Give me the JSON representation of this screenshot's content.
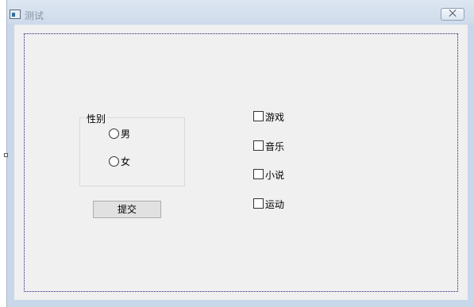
{
  "window": {
    "title": "测试",
    "close_glyph": "⨉"
  },
  "gender_group": {
    "title": "性别",
    "options": [
      {
        "label": "男"
      },
      {
        "label": "女"
      }
    ]
  },
  "submit_label": "提交",
  "hobbies": [
    {
      "label": "游戏"
    },
    {
      "label": "音乐"
    },
    {
      "label": "小说"
    },
    {
      "label": "运动"
    }
  ]
}
